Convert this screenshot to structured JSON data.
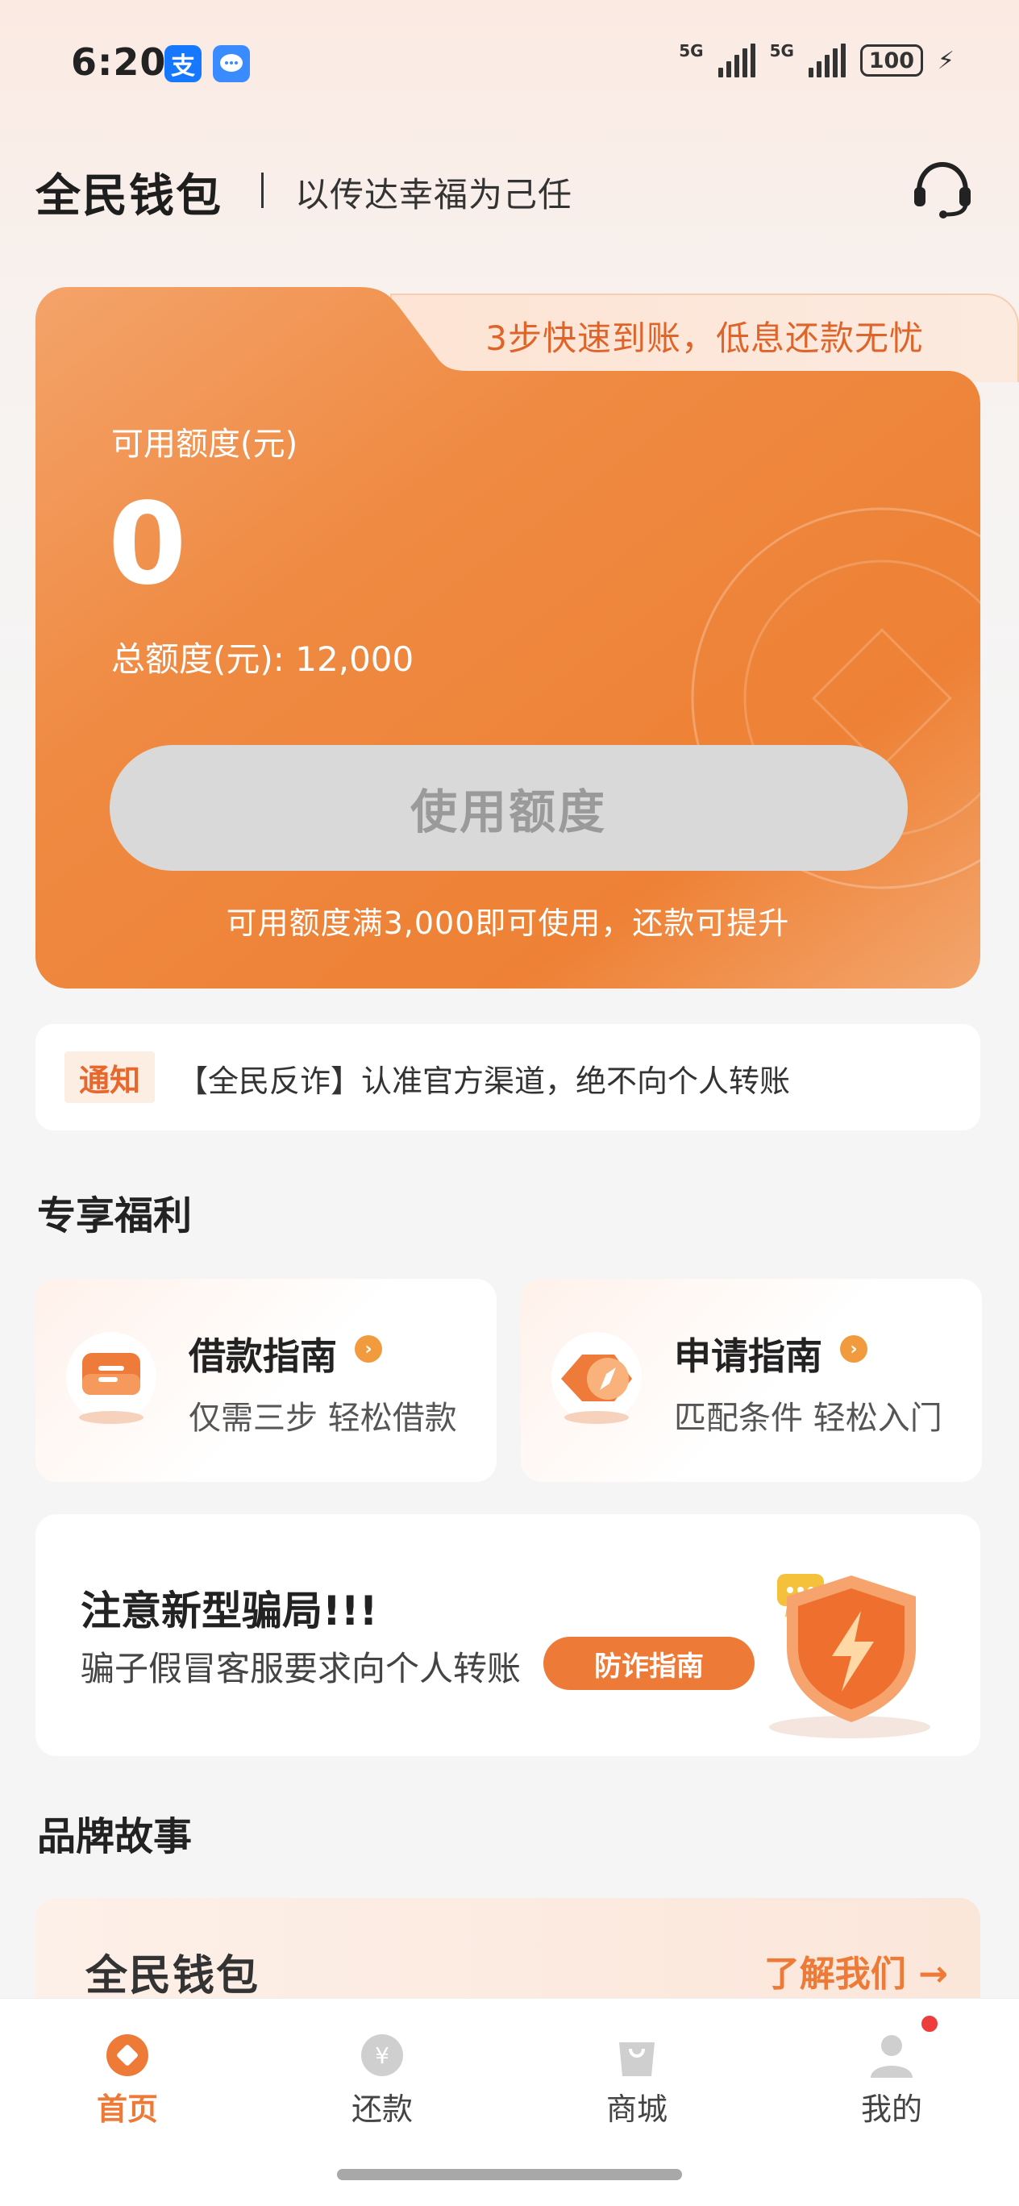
{
  "status_bar": {
    "time": "6:20",
    "app_icons": [
      {
        "name": "alipay-icon",
        "glyph": "支",
        "color": "#1677ff"
      },
      {
        "name": "message-icon",
        "glyph": "💬",
        "color": "#3a8bff"
      }
    ],
    "network_1": "5G",
    "network_2": "5G",
    "battery": "100"
  },
  "header": {
    "logo": "全民钱包",
    "slogan": "以传达幸福为己任",
    "service_icon": "headset-icon"
  },
  "credit_card": {
    "tab_text": "3步快速到账，低息还款无忧",
    "available_label": "可用额度(元)",
    "available_amount": "0",
    "total_text": "总额度(元): 12,000",
    "use_button": "使用额度",
    "tip": "可用额度满3,000即可使用，还款可提升",
    "accent": "#ee7a38"
  },
  "notice": {
    "tag": "通知",
    "text": "【全民反诈】认准官方渠道，绝不向个人转账"
  },
  "benefits": {
    "title": "专享福利",
    "items": [
      {
        "title": "借款指南",
        "desc": "仅需三步  轻松借款",
        "icon": "ticket-icon"
      },
      {
        "title": "申请指南",
        "desc": "匹配条件  轻松入门",
        "icon": "compass-icon"
      }
    ]
  },
  "fraud": {
    "title": "注意新型骗局!!!",
    "desc": "骗子假冒客服要求向个人转账",
    "button": "防诈指南",
    "icon": "shield-icon"
  },
  "brand": {
    "title": "品牌故事",
    "name": "全民钱包",
    "link": "了解我们 →"
  },
  "bottom_nav": [
    {
      "label": "首页",
      "icon": "home-icon",
      "active": true
    },
    {
      "label": "还款",
      "icon": "repay-icon",
      "active": false
    },
    {
      "label": "商城",
      "icon": "shop-icon",
      "active": false
    },
    {
      "label": "我的",
      "icon": "profile-icon",
      "active": false
    }
  ]
}
